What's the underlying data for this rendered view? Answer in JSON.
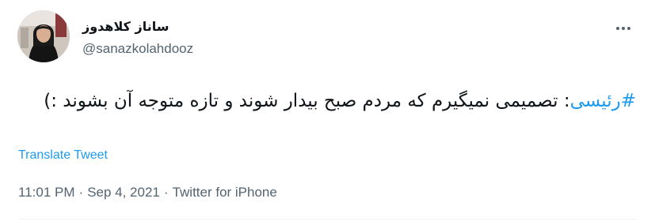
{
  "author": {
    "display_name": "ساناز کلاهدوز",
    "handle": "@sanazkolahdooz"
  },
  "more_menu": {
    "icon": "more-horizontal-icon"
  },
  "tweet": {
    "hashtag": "#رئیسی",
    "text": ": تصمیمی نمیگیرم که مردم صبح بیدار شوند و تازه متوجه آن بشوند :)"
  },
  "translate_label": "Translate Tweet",
  "meta": {
    "time": "11:01 PM",
    "separator": "·",
    "date": "Sep 4, 2021",
    "source": "Twitter for iPhone"
  },
  "colors": {
    "link": "#1d9bf0",
    "secondary_text": "#536471",
    "primary_text": "#0f1419"
  }
}
